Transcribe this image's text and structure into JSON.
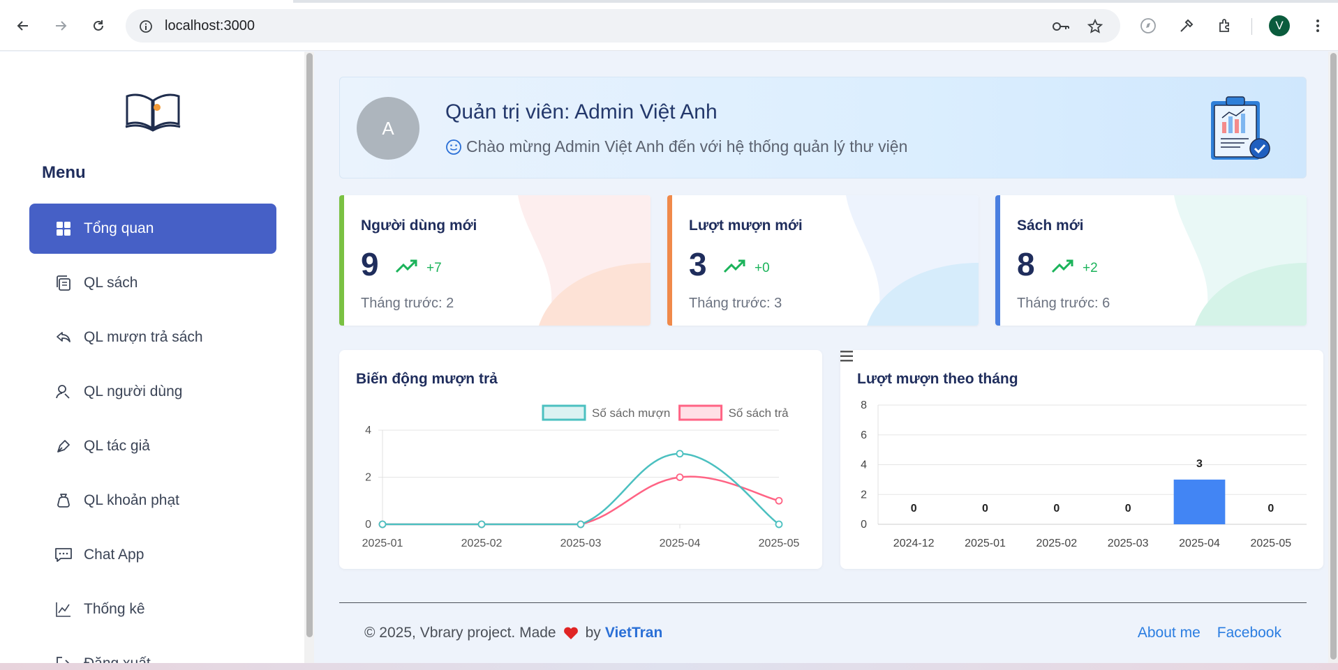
{
  "browser": {
    "url": "localhost:3000",
    "profile_initial": "V"
  },
  "sidebar": {
    "menu_title": "Menu",
    "items": [
      {
        "label": "Tổng quan",
        "icon": "grid-icon"
      },
      {
        "label": "QL sách",
        "icon": "copy-icon"
      },
      {
        "label": "QL mượn trả sách",
        "icon": "reply-icon"
      },
      {
        "label": "QL người dùng",
        "icon": "user-search-icon"
      },
      {
        "label": "QL tác giả",
        "icon": "pen-icon"
      },
      {
        "label": "QL khoản phạt",
        "icon": "money-bag-icon"
      },
      {
        "label": "Chat App",
        "icon": "chat-icon"
      },
      {
        "label": "Thống kê",
        "icon": "line-chart-icon"
      },
      {
        "label": "Đăng xuất",
        "icon": "logout-icon"
      }
    ]
  },
  "welcome": {
    "avatar_initial": "A",
    "title": "Quản trị viên: Admin Việt Anh",
    "subtitle": "Chào mừng Admin Việt Anh đến với hệ thống quản lý thư viện"
  },
  "stats": [
    {
      "title": "Người dùng mới",
      "value": "9",
      "delta": "+7",
      "previous": "Tháng trước: 2",
      "color": "#7ac142"
    },
    {
      "title": "Lượt mượn mới",
      "value": "3",
      "delta": "+0",
      "previous": "Tháng trước: 3",
      "color": "#f0894a"
    },
    {
      "title": "Sách mới",
      "value": "8",
      "delta": "+2",
      "previous": "Tháng trước: 6",
      "color": "#4a7fe0"
    }
  ],
  "cards": {
    "borrow_return_title": "Biến động mượn trả",
    "monthly_title": "Lượt mượn theo tháng"
  },
  "chart_data": [
    {
      "type": "line",
      "title": "Biến động mượn trả",
      "x": [
        "2025-01",
        "2025-02",
        "2025-03",
        "2025-04",
        "2025-05"
      ],
      "series": [
        {
          "name": "Số sách mượn",
          "values": [
            0,
            0,
            0,
            3,
            0
          ],
          "color": "#4bc0c0"
        },
        {
          "name": "Số sách trả",
          "values": [
            0,
            0,
            0,
            2,
            1
          ],
          "color": "#ff6384"
        }
      ],
      "ylim": [
        0,
        4
      ],
      "yticks": [
        0,
        2,
        4
      ],
      "legend": "top-right",
      "grid": true
    },
    {
      "type": "bar",
      "title": "Lượt mượn theo tháng",
      "categories": [
        "2024-12",
        "2025-01",
        "2025-02",
        "2025-03",
        "2025-04",
        "2025-05"
      ],
      "values": [
        0,
        0,
        0,
        0,
        3,
        0
      ],
      "ylim": [
        0,
        8
      ],
      "yticks": [
        0,
        2,
        4,
        6,
        8
      ],
      "grid": true,
      "color": "#4285f4"
    }
  ],
  "footer": {
    "copyright": "© 2025, Vbrary project. Made",
    "by": "by",
    "author": "VietTran",
    "links": [
      "About me",
      "Facebook"
    ]
  }
}
